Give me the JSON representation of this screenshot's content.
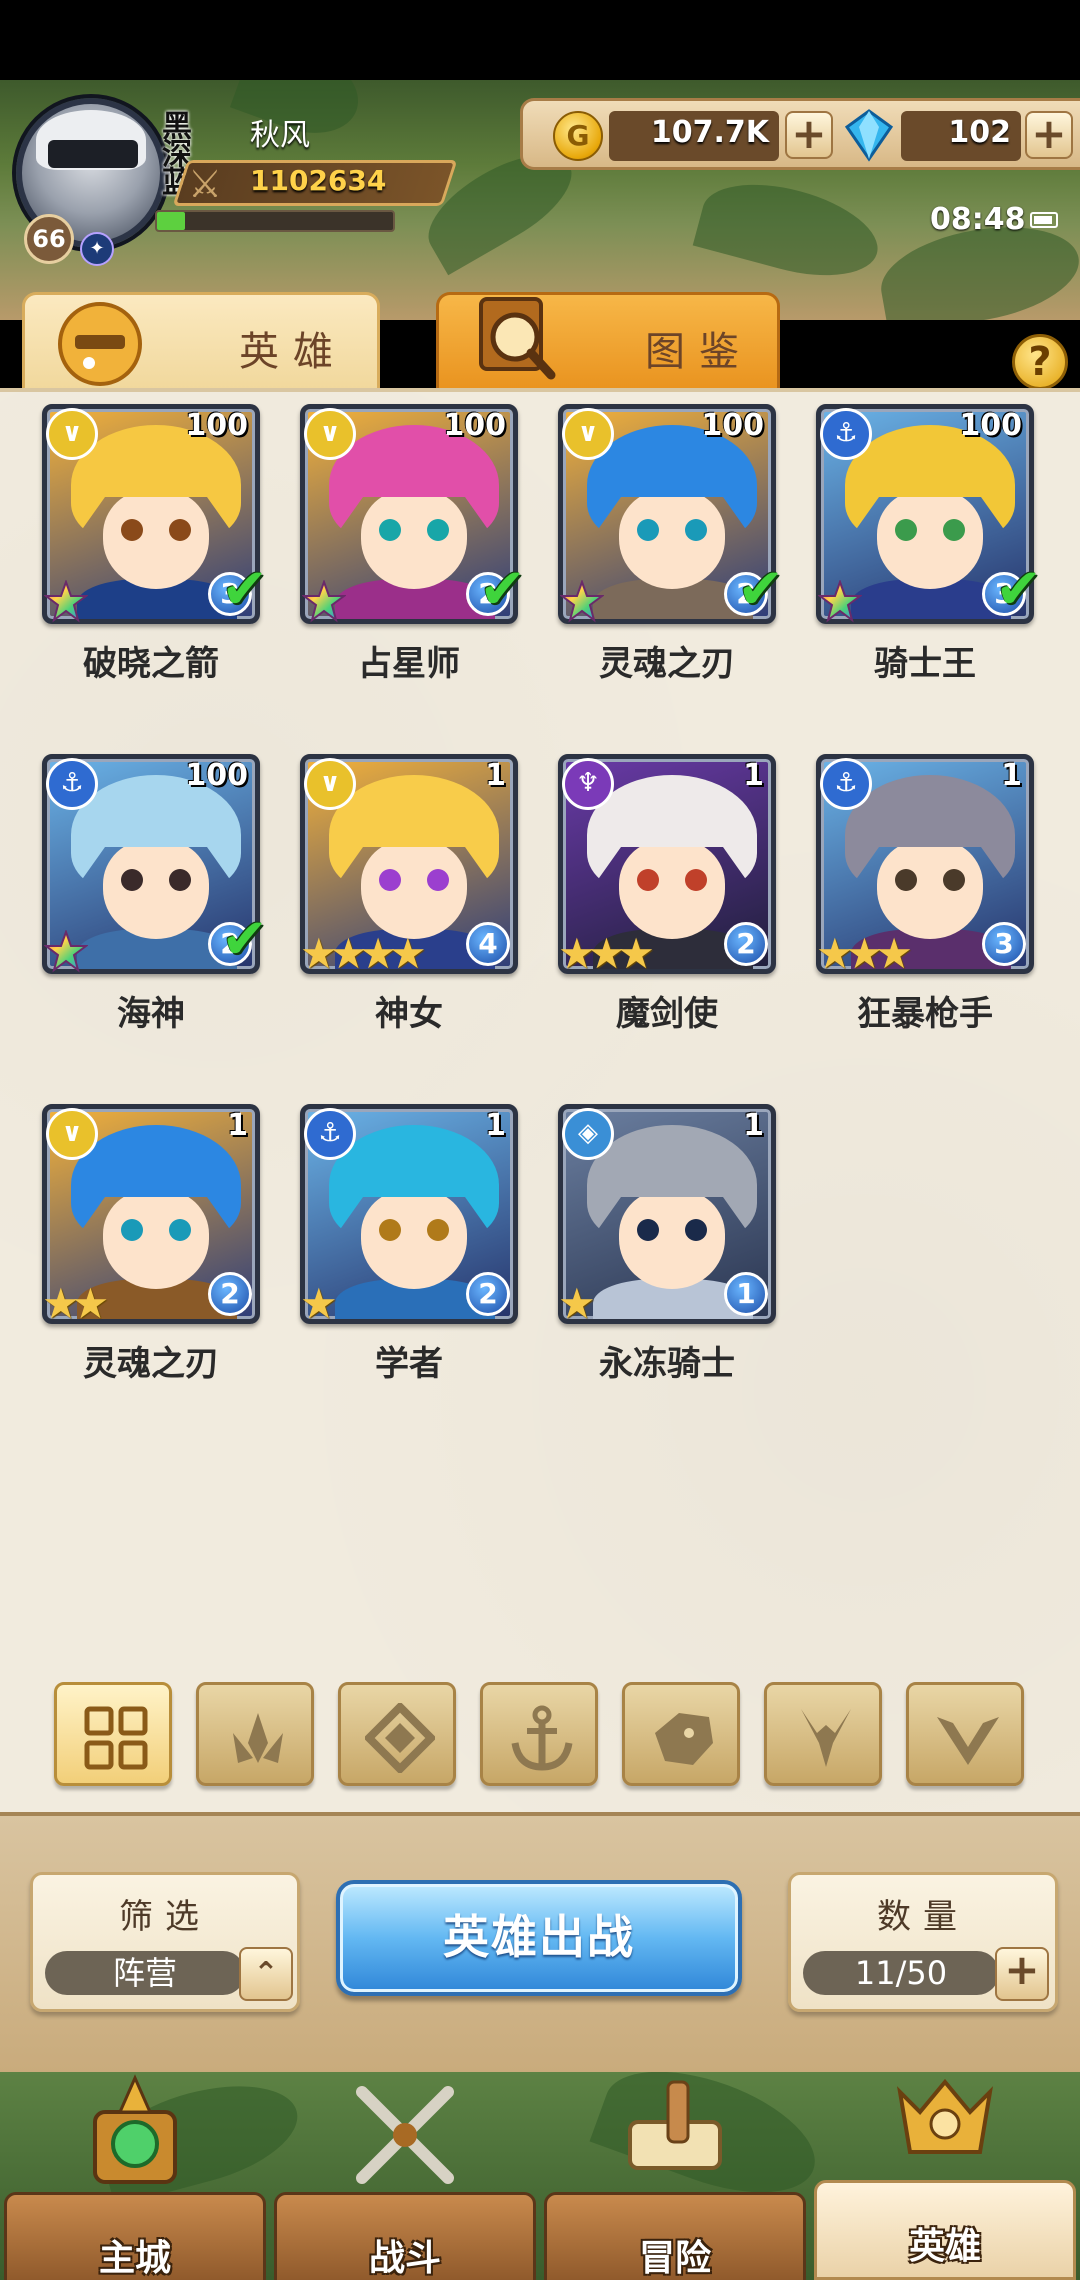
{
  "player": {
    "name": "秋风",
    "clan": "黑深蓝",
    "level": "66",
    "power": "1102634",
    "exp_fraction": 0.12
  },
  "resources": {
    "gold": "107.7K",
    "gems": "102"
  },
  "status": {
    "time": "08:48"
  },
  "tabs": [
    {
      "label": "英雄",
      "active": true,
      "icon": "knight-helmet-icon"
    },
    {
      "label": "图鉴",
      "active": false,
      "icon": "magnifier-book-icon"
    }
  ],
  "help_label": "?",
  "heroes": [
    {
      "name": "破晓之箭",
      "level": "100",
      "faction": "wing",
      "grade": "3",
      "stars": 0,
      "rainbow": true,
      "check": true,
      "hair": "#f6c842",
      "eye": "#8a4a1a",
      "outfit": "#1d3f88"
    },
    {
      "name": "占星师",
      "level": "100",
      "faction": "wing",
      "grade": "2",
      "stars": 0,
      "rainbow": true,
      "check": true,
      "hair": "#e14fa9",
      "eye": "#18a6a8",
      "outfit": "#9b2f8a"
    },
    {
      "name": "灵魂之刃",
      "level": "100",
      "faction": "wing",
      "grade": "2",
      "stars": 0,
      "rainbow": true,
      "check": true,
      "hair": "#2c87e2",
      "eye": "#1a9ab8",
      "outfit": "#7c6a5a"
    },
    {
      "name": "骑士王",
      "level": "100",
      "faction": "anchor",
      "grade": "3",
      "stars": 0,
      "rainbow": true,
      "check": true,
      "hair": "#f2c737",
      "eye": "#3b9b4c",
      "outfit": "#2a3d8c"
    },
    {
      "name": "海神",
      "level": "100",
      "faction": "anchor",
      "grade": "2",
      "stars": 0,
      "rainbow": true,
      "check": true,
      "hair": "#a7d6ee",
      "eye": "#3a2a2a",
      "outfit": "#3e6fa8"
    },
    {
      "name": "神女",
      "level": "1",
      "faction": "wing",
      "grade": "4",
      "stars": 4,
      "rainbow": false,
      "check": false,
      "hair": "#f8cc4a",
      "eye": "#9b3fcf",
      "outfit": "#2a3f8c"
    },
    {
      "name": "魔剑使",
      "level": "1",
      "faction": "demon",
      "grade": "2",
      "stars": 3,
      "rainbow": false,
      "check": false,
      "hair": "#eeeaea",
      "eye": "#c0402a",
      "outfit": "#2d2d3a"
    },
    {
      "name": "狂暴枪手",
      "level": "1",
      "faction": "anchor",
      "grade": "3",
      "stars": 3,
      "rainbow": false,
      "check": false,
      "hair": "#8c8a9c",
      "eye": "#4a3a2a",
      "outfit": "#5a2f6c"
    },
    {
      "name": "灵魂之刃",
      "level": "1",
      "faction": "wing",
      "grade": "2",
      "stars": 2,
      "rainbow": false,
      "check": false,
      "hair": "#2c87e2",
      "eye": "#1a9ab8",
      "outfit": "#8a5a28"
    },
    {
      "name": "学者",
      "level": "1",
      "faction": "anchor",
      "grade": "2",
      "stars": 1,
      "rainbow": false,
      "check": false,
      "hair": "#29b6e0",
      "eye": "#b07a1a",
      "outfit": "#2a6fb8"
    },
    {
      "name": "永冻骑士",
      "level": "1",
      "faction": "diamond",
      "grade": "1",
      "stars": 1,
      "rainbow": false,
      "check": false,
      "hair": "#a2a8b4",
      "eye": "#1a2a4a",
      "outfit": "#b8c4d6"
    }
  ],
  "filters": [
    {
      "name": "all",
      "icon": "grid-icon",
      "active": true
    },
    {
      "name": "nature",
      "icon": "leaf-crown-icon",
      "active": false
    },
    {
      "name": "ice",
      "icon": "diamond-icon",
      "active": false
    },
    {
      "name": "ocean",
      "icon": "anchor-icon",
      "active": false
    },
    {
      "name": "beast",
      "icon": "beast-head-icon",
      "active": false
    },
    {
      "name": "demon",
      "icon": "demon-horns-icon",
      "active": false
    },
    {
      "name": "light",
      "icon": "wing-v-icon",
      "active": false
    }
  ],
  "controls": {
    "filter_title": "筛选",
    "filter_value": "阵营",
    "deploy_label": "英雄出战",
    "count_title": "数量",
    "count_value": "11/50"
  },
  "nav": [
    {
      "label": "主城",
      "icon": "castle-icon",
      "active": false
    },
    {
      "label": "战斗",
      "icon": "crossed-swords-icon",
      "active": false
    },
    {
      "label": "冒险",
      "icon": "scroll-map-icon",
      "active": false
    },
    {
      "label": "英雄",
      "icon": "hero-helmet-icon",
      "active": true
    }
  ],
  "colors": {
    "panel": "#f1ebde",
    "faction_wing": "#e9c12b",
    "faction_anchor": "#2f6bd1",
    "faction_demon": "#7b3ab8",
    "faction_diamond": "#3a8fd6"
  }
}
